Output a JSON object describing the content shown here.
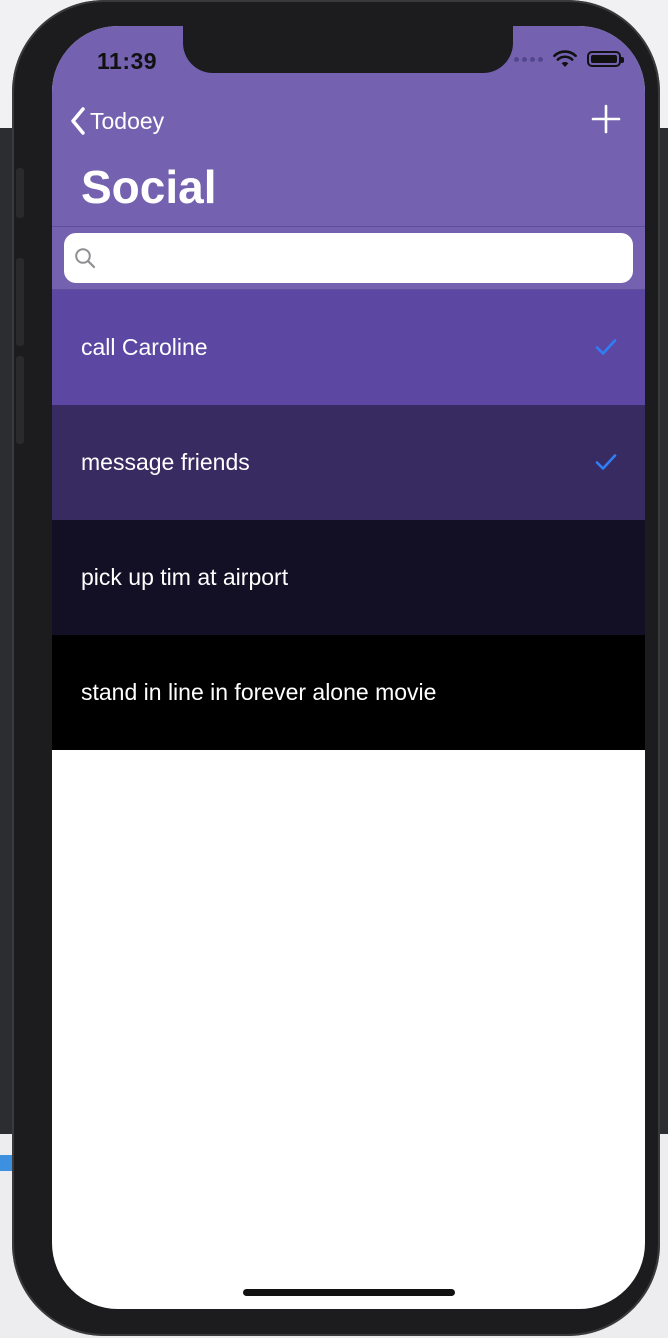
{
  "status_bar": {
    "time": "11:39"
  },
  "nav": {
    "back_label": "Todoey",
    "back_icon": "chevron-left-icon",
    "add_icon": "plus-icon"
  },
  "title": "Social",
  "search": {
    "placeholder": "",
    "icon": "search-icon"
  },
  "items": [
    {
      "label": "call Caroline",
      "checked": true,
      "color": "#5c48a3"
    },
    {
      "label": "message friends",
      "checked": true,
      "color": "#382b62"
    },
    {
      "label": "pick up tim at airport",
      "checked": false,
      "color": "#131026"
    },
    {
      "label": "stand in line in forever alone movie",
      "checked": false,
      "color": "#000000"
    }
  ],
  "colors": {
    "nav_bar": "#7462b1",
    "checkmark": "#2f7ef6"
  }
}
